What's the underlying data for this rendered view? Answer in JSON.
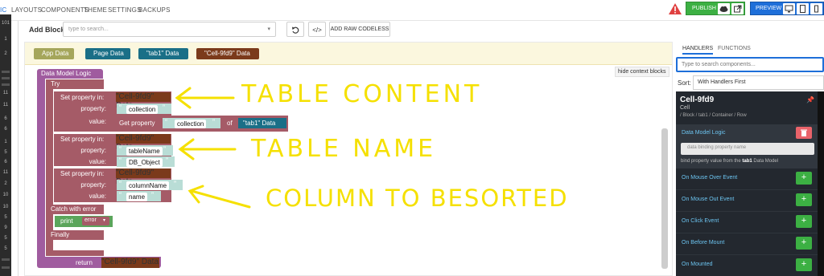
{
  "nav": {
    "first_fragment": "IC",
    "items": [
      "LAYOUTS",
      "COMPONENTS",
      "THEME",
      "SETTINGS",
      "BACKUPS"
    ]
  },
  "header": {
    "publish_label": "PUBLISH",
    "preview_label": "PREVIEW"
  },
  "gutter_numbers": [
    "101",
    "1",
    "2",
    "11",
    "11",
    "6",
    "6",
    "1",
    "5",
    "6",
    "11",
    "2",
    "10",
    "10",
    "5",
    "9",
    "5",
    "5"
  ],
  "toolbar": {
    "add_block_label": "Add Block:",
    "search_placeholder": "type to search...",
    "raw_codeless_label": "ADD RAW CODELESS"
  },
  "block_palette": [
    "App Data",
    "Page Data",
    "\"tab1\" Data",
    "\"Cell-9fd9\" Data"
  ],
  "workspace": {
    "hide_context_label": "hide context blocks"
  },
  "logic": {
    "root_label": "Data Model Logic",
    "try_label": "Try",
    "set_label": "Set property in:",
    "property_label": "property:",
    "value_label": "value:",
    "target": "\"Cell-9fd9\" Data",
    "get_property_label": "Get property",
    "of_label": "of",
    "tab1_data": "\"tab1\" Data",
    "quote_open": "“",
    "quote_close": "”",
    "set1": {
      "property": "collection",
      "value_property": "collection"
    },
    "set2": {
      "property": "tableName",
      "value": "DB_Object"
    },
    "set3": {
      "property": "columnName",
      "value": "name"
    },
    "catch_label": "Catch with error",
    "print_label": "print",
    "error_var": "error",
    "finally_label": "Finally",
    "return_label": "return"
  },
  "annotations": [
    "TABLE CONTENT",
    "TABLE NAME",
    "COLUMN TO BESORTED"
  ],
  "right_panel": {
    "tabs": [
      "HANDLERS",
      "FUNCTIONS"
    ],
    "search_placeholder": "Type to search components...",
    "sort_label": "Sort:",
    "sort_value": "With Handlers First",
    "component_name": "Cell-9fd9",
    "component_type": "Cell",
    "component_path": "/ Block / tab1 / Container / Row",
    "data_model_logic_label": "Data Model Logic",
    "binding_placeholder": "data binding property name",
    "binding_hint_prefix": "bind property value from the",
    "binding_hint_bold": "tab1",
    "binding_hint_suffix": "Data Model",
    "events": [
      "On Mouse Over Event",
      "On Mouse Out Event",
      "On Click Event",
      "On Before Mount",
      "On Mounted"
    ],
    "plus_label": "+"
  },
  "colors": {
    "accent": "#1e6fd9",
    "publish": "#3cb043",
    "annotation": "#f5e000",
    "logic_purple": "#a05c9f",
    "data_brown": "#7b3a1b"
  }
}
